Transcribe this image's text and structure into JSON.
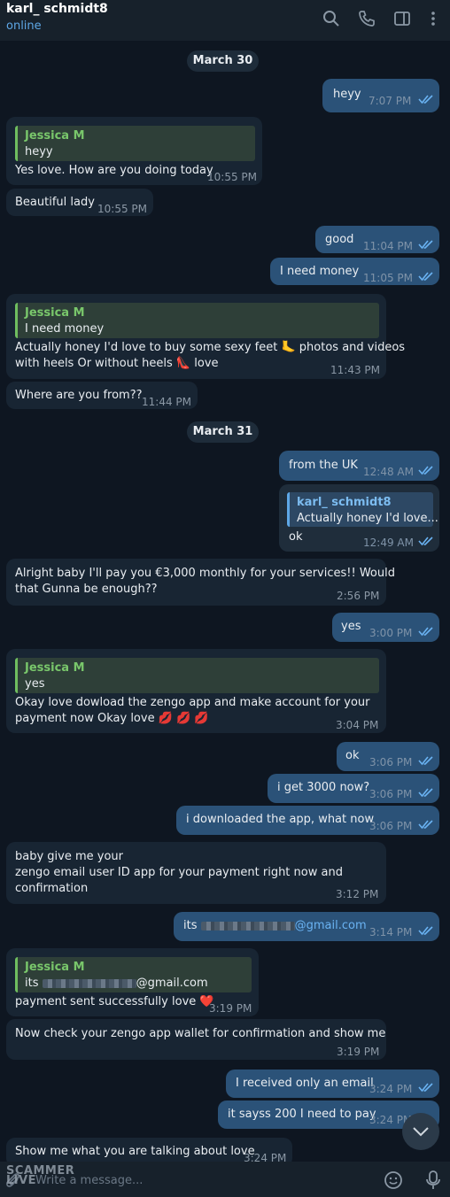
{
  "header": {
    "name": "karl_ schmidt8",
    "status": "online",
    "icons": [
      "search-icon",
      "phone-icon",
      "sidebar-toggle-icon",
      "more-vertical-icon"
    ]
  },
  "dates": [
    "March 30",
    "March 31"
  ],
  "messages": [
    {
      "dir": "out",
      "text": "heyy",
      "time": "7:07 PM"
    },
    {
      "dir": "in",
      "reply": {
        "author": "Jessica M",
        "text": "heyy"
      },
      "text": "Yes love. How are you doing today",
      "time": "10:55 PM"
    },
    {
      "dir": "in",
      "text": "Beautiful lady",
      "time": "10:55 PM"
    },
    {
      "dir": "out",
      "text": "good",
      "time": "11:04 PM"
    },
    {
      "dir": "out",
      "text": "I need money",
      "time": "11:05 PM"
    },
    {
      "dir": "in",
      "reply": {
        "author": "Jessica M",
        "text": "I need money"
      },
      "lines": [
        "Actually honey I'd love to buy some sexy feet 🦶 photos and videos",
        "with heels Or  without heels 👠 love"
      ],
      "time": "11:43 PM"
    },
    {
      "dir": "in",
      "text": "Where are you from??",
      "time": "11:44 PM"
    },
    {
      "dir": "out",
      "text": "from the UK",
      "time": "12:48 AM"
    },
    {
      "dir": "out",
      "reply": {
        "author": "karl_ schmidt8",
        "text": "Actually honey I'd love..."
      },
      "text": "ok",
      "time": "12:49 AM"
    },
    {
      "dir": "in",
      "lines": [
        "Alright baby I'll pay you €3,000 monthly  for your services!! Would",
        "that Gunna be  enough??"
      ],
      "time": "2:56 PM"
    },
    {
      "dir": "out",
      "text": "yes",
      "time": "3:00 PM"
    },
    {
      "dir": "in",
      "reply": {
        "author": "Jessica M",
        "text": "yes"
      },
      "lines": [
        "Okay love dowload the zengo app and make account for your",
        "payment now Okay love 💋 💋 💋"
      ],
      "time": "3:04 PM"
    },
    {
      "dir": "out",
      "text": "ok",
      "time": "3:06 PM"
    },
    {
      "dir": "out",
      "text": "i get 3000 now?",
      "time": "3:06 PM"
    },
    {
      "dir": "out",
      "text": "i downloaded the app, what now",
      "time": "3:06 PM"
    },
    {
      "dir": "in",
      "lines": [
        "baby give me your",
        "zengo email user ID  app for your payment right now and",
        "confirmation"
      ],
      "time": "3:12 PM"
    },
    {
      "dir": "out",
      "text_prefix": "its",
      "text_suffix": "@gmail.com",
      "time": "3:14 PM"
    },
    {
      "dir": "in",
      "reply": {
        "author": "Jessica M",
        "text_prefix": "its",
        "text_suffix": "@gmail.com"
      },
      "text": "payment sent successfully love ❤️",
      "time": "3:19 PM"
    },
    {
      "dir": "in",
      "text": "Now check your zengo app wallet for confirmation and show me",
      "time": "3:19 PM"
    },
    {
      "dir": "out",
      "text": "I received only an email",
      "time": "3:24 PM"
    },
    {
      "dir": "out",
      "text": "it sayss 200 I need to pay",
      "time": "3:24 PM"
    },
    {
      "dir": "in",
      "text": "Show me what you are talking about love",
      "time": "3:24 PM"
    }
  ],
  "composer": {
    "placeholder": "Write a message..."
  },
  "watermark": {
    "line1": "SCAMMER",
    "line2": "LIVE"
  },
  "colors": {
    "background": "#0e1621",
    "incoming": "#182533",
    "outgoing": "#2b5278",
    "accent": "#5ea7e6",
    "reply_author": "#79c76b"
  }
}
